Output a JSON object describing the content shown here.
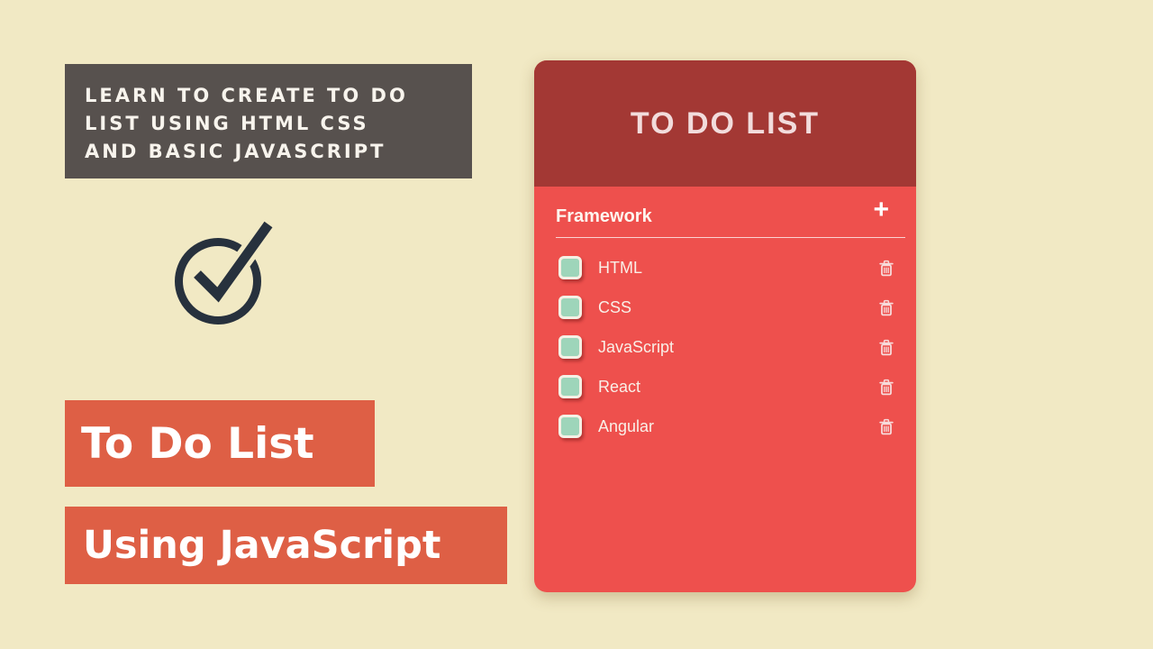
{
  "colors": {
    "background": "#f1e9c4",
    "headline_banner_bg": "#57514e",
    "headline_text": "#f8f4ed",
    "badge_bg": "#de5f45",
    "badge_text": "#ffffff",
    "card_header_bg": "#a33834",
    "card_header_text": "#f2dcdc",
    "card_body_bg": "#ee504d",
    "checkbox_fill": "#9ed5ba",
    "checkbox_border": "#f5f0e5",
    "trash_icon": "#f7dbdb",
    "check_icon": "#27313d"
  },
  "headline": {
    "lines": [
      "LEARN TO CREATE TO DO",
      "LIST USING HTML CSS",
      "AND BASIC JAVASCRIPT"
    ]
  },
  "badges": [
    {
      "label": "To Do List"
    },
    {
      "label": "Using JavaScript"
    }
  ],
  "todo_app": {
    "title": "TO DO LIST",
    "list_name": "Framework",
    "add_button_label": "+",
    "items": [
      {
        "label": "HTML",
        "checked": false
      },
      {
        "label": "CSS",
        "checked": false
      },
      {
        "label": "JavaScript",
        "checked": false
      },
      {
        "label": "React",
        "checked": false
      },
      {
        "label": "Angular",
        "checked": false
      }
    ]
  }
}
